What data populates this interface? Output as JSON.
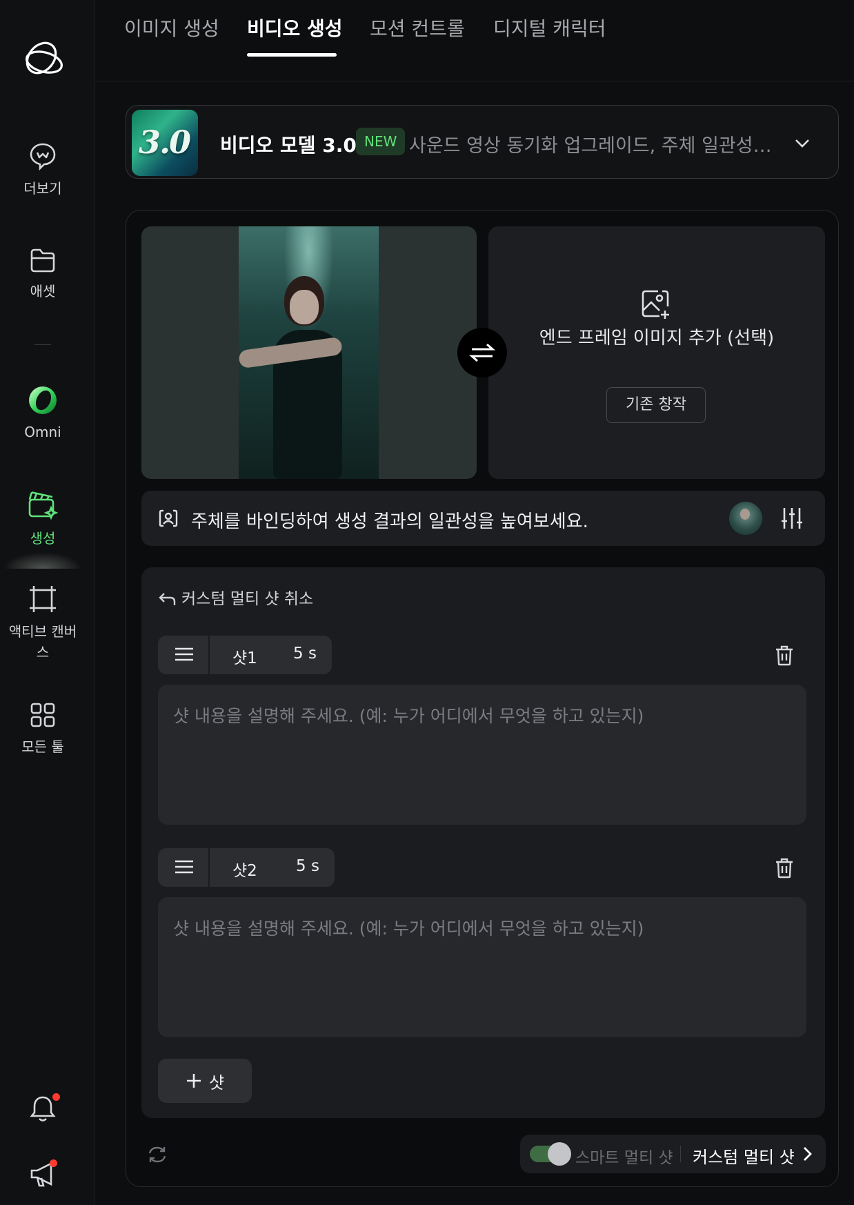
{
  "sidebar": {
    "items": [
      {
        "label": "더보기",
        "icon": "chat-bubble-icon"
      },
      {
        "label": "애셋",
        "icon": "folder-icon"
      },
      {
        "label": "Omni",
        "icon": "omni-ring-icon"
      },
      {
        "label": "생성",
        "icon": "clapper-sparkle-icon",
        "active": true
      },
      {
        "label": "액티브 캔버스",
        "icon": "canvas-crop-icon"
      },
      {
        "label": "모든 툴",
        "icon": "grid-icon"
      }
    ],
    "notifications_icon": "bell-icon",
    "announcements_icon": "megaphone-icon"
  },
  "tabs": [
    {
      "label": "이미지 생성"
    },
    {
      "label": "비디오 생성",
      "active": true
    },
    {
      "label": "모션 컨트롤"
    },
    {
      "label": "디지털 캐릭터"
    }
  ],
  "model": {
    "thumb_text": "3.0",
    "name": "비디오 모델 3.0",
    "badge": "NEW",
    "description": "사운드 영상 동기화 업그레이드, 주체 일관성 ..."
  },
  "frames": {
    "end_title": "엔드 프레임 이미지 추가 (선택)",
    "existing_button": "기존 창작"
  },
  "bind": {
    "text": "주체를 바인딩하여 생성 결과의 일관성을 높여보세요."
  },
  "shots": {
    "cancel_label": "커스텀 멀티 샷 취소",
    "items": [
      {
        "name": "샷1",
        "duration": "5 s",
        "value": "",
        "placeholder": "샷 내용을 설명해 주세요. (예: 누가 어디에서 무엇을 하고 있는지)"
      },
      {
        "name": "샷2",
        "duration": "5 s",
        "value": "",
        "placeholder": "샷 내용을 설명해 주세요. (예: 누가 어디에서 무엇을 하고 있는지)"
      }
    ],
    "add_label": "샷"
  },
  "bottom": {
    "smart_label": "스마트 멀티 샷",
    "custom_label": "커스텀 멀티 샷"
  },
  "colors": {
    "accent": "#5fe27b",
    "background": "#0d0e10",
    "notification_dot": "#ff3b30"
  }
}
